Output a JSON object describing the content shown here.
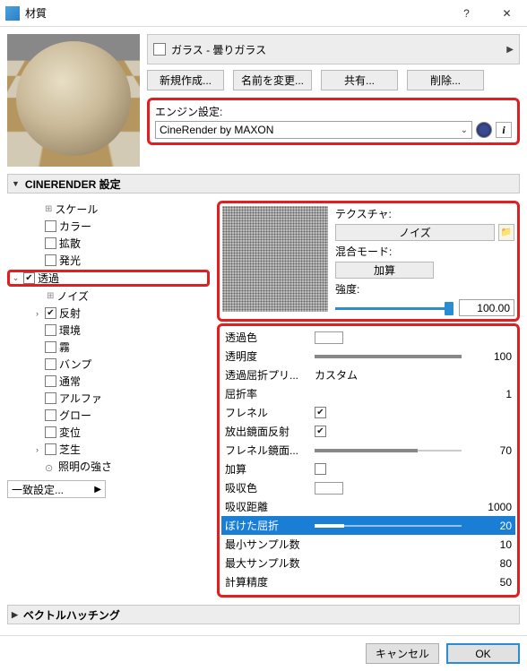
{
  "window": {
    "title": "材質",
    "help": "?",
    "close": "✕"
  },
  "material": {
    "name": "ガラス - 曇りガラス"
  },
  "buttons": {
    "new": "新規作成...",
    "rename": "名前を変更...",
    "share": "共有...",
    "delete": "削除..."
  },
  "engine": {
    "label": "エンジン設定:",
    "value": "CineRender by MAXON"
  },
  "sections": {
    "cinerender": "CINERENDER 設定",
    "vector": "ベクトルハッチング"
  },
  "tree": {
    "scale": "スケール",
    "color": "カラー",
    "diffusion": "拡散",
    "luminance": "発光",
    "transparency": "透過",
    "noise": "ノイズ",
    "reflectance": "反射",
    "environment": "環境",
    "fog": "霧",
    "bump": "バンプ",
    "normal": "通常",
    "alpha": "アルファ",
    "glow": "グロー",
    "displacement": "変位",
    "grass": "芝生",
    "illumination": "照明の強さ"
  },
  "matched": "一致設定...",
  "texture": {
    "label": "テクスチャ:",
    "button": "ノイズ",
    "mixmode_label": "混合モード:",
    "mixmode_value": "加算",
    "strength_label": "強度:",
    "strength_value": "100.00"
  },
  "props": {
    "trans_color": "透過色",
    "brightness": {
      "label": "透明度",
      "value": 100
    },
    "refraction_preset": {
      "label": "透過屈折プリ...",
      "value": "カスタム"
    },
    "refraction": {
      "label": "屈折率",
      "value": 1
    },
    "fresnel": "フレネル",
    "total_internal": "放出鏡面反射",
    "fresnel_refl": {
      "label": "フレネル鏡面...",
      "value": 70
    },
    "additive": "加算",
    "absorption_color": "吸収色",
    "absorption_dist": {
      "label": "吸収距離",
      "value": 1000
    },
    "blurriness": {
      "label": "ぼけた屈折",
      "value": 20
    },
    "min_samples": {
      "label": "最小サンプル数",
      "value": 10
    },
    "max_samples": {
      "label": "最大サンプル数",
      "value": 80
    },
    "accuracy": {
      "label": "計算精度",
      "value": 50
    }
  },
  "footer": {
    "cancel": "キャンセル",
    "ok": "OK"
  }
}
